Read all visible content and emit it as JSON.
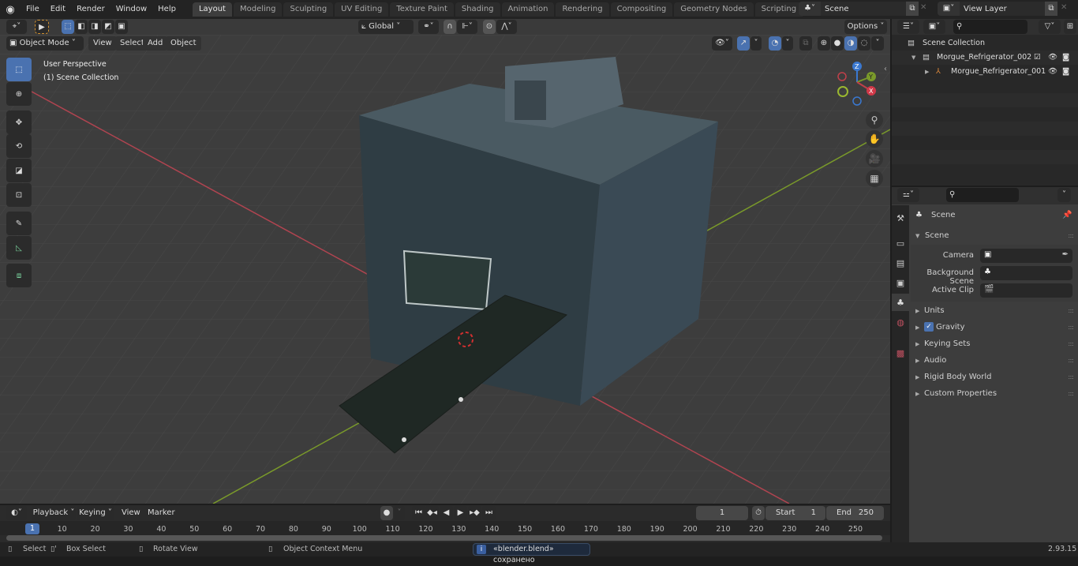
{
  "app": {
    "name": "Blender",
    "version": "2.93.15"
  },
  "menu": [
    "File",
    "Edit",
    "Render",
    "Window",
    "Help"
  ],
  "workspaces": [
    {
      "label": "Layout",
      "active": true
    },
    {
      "label": "Modeling"
    },
    {
      "label": "Sculpting"
    },
    {
      "label": "UV Editing"
    },
    {
      "label": "Texture Paint"
    },
    {
      "label": "Shading"
    },
    {
      "label": "Animation"
    },
    {
      "label": "Rendering"
    },
    {
      "label": "Compositing"
    },
    {
      "label": "Geometry Nodes"
    },
    {
      "label": "Scripting"
    }
  ],
  "scene_selector": {
    "value": "Scene"
  },
  "view_layer_selector": {
    "value": "View Layer"
  },
  "viewport_header": {
    "mode": "Object Mode",
    "menus": [
      "View",
      "Select",
      "Add",
      "Object"
    ],
    "orientation": "Global",
    "options_label": "Options"
  },
  "viewport": {
    "view_name": "User Perspective",
    "collection_info": "(1) Scene Collection",
    "gizmo_axes": {
      "x": "X",
      "y": "Y",
      "z": "Z"
    },
    "colors": {
      "x_axis": "#c0404a",
      "y_axis": "#7a9a2a",
      "z_axis": "#3a78d0",
      "grid_bg": "#3c3c3c",
      "accent": "#4a72b0"
    }
  },
  "toolbar": [
    "select-box",
    "cursor",
    "move",
    "rotate",
    "scale",
    "transform",
    "annotate",
    "measure",
    "add-cube"
  ],
  "outliner": {
    "root": "Scene Collection",
    "items": [
      {
        "name": "Morgue_Refrigerator_002",
        "type": "collection",
        "checked": true
      },
      {
        "name": "Morgue_Refrigerator_001",
        "type": "empty"
      }
    ]
  },
  "properties": {
    "context": "Scene",
    "section": "Scene",
    "fields": [
      {
        "label": "Camera",
        "value": ""
      },
      {
        "label": "Background Scene",
        "value": ""
      },
      {
        "label": "Active Clip",
        "value": ""
      }
    ],
    "panels": [
      {
        "label": "Units"
      },
      {
        "label": "Gravity",
        "checkbox": true
      },
      {
        "label": "Keying Sets"
      },
      {
        "label": "Audio"
      },
      {
        "label": "Rigid Body World"
      },
      {
        "label": "Custom Properties"
      }
    ]
  },
  "timeline": {
    "menus": [
      "Playback",
      "Keying",
      "View",
      "Marker"
    ],
    "current_frame": "1",
    "start_label": "Start",
    "start": "1",
    "end_label": "End",
    "end": "250",
    "ticks": [
      "1",
      "10",
      "20",
      "30",
      "40",
      "50",
      "60",
      "70",
      "80",
      "90",
      "100",
      "110",
      "120",
      "130",
      "140",
      "150",
      "160",
      "170",
      "180",
      "190",
      "200",
      "210",
      "220",
      "230",
      "240",
      "250"
    ]
  },
  "statusbar": {
    "select": "Select",
    "box_select": "Box Select",
    "rotate_view": "Rotate View",
    "context_menu": "Object Context Menu",
    "message": "«blender.blend» сохранено",
    "version": "2.93.15"
  }
}
